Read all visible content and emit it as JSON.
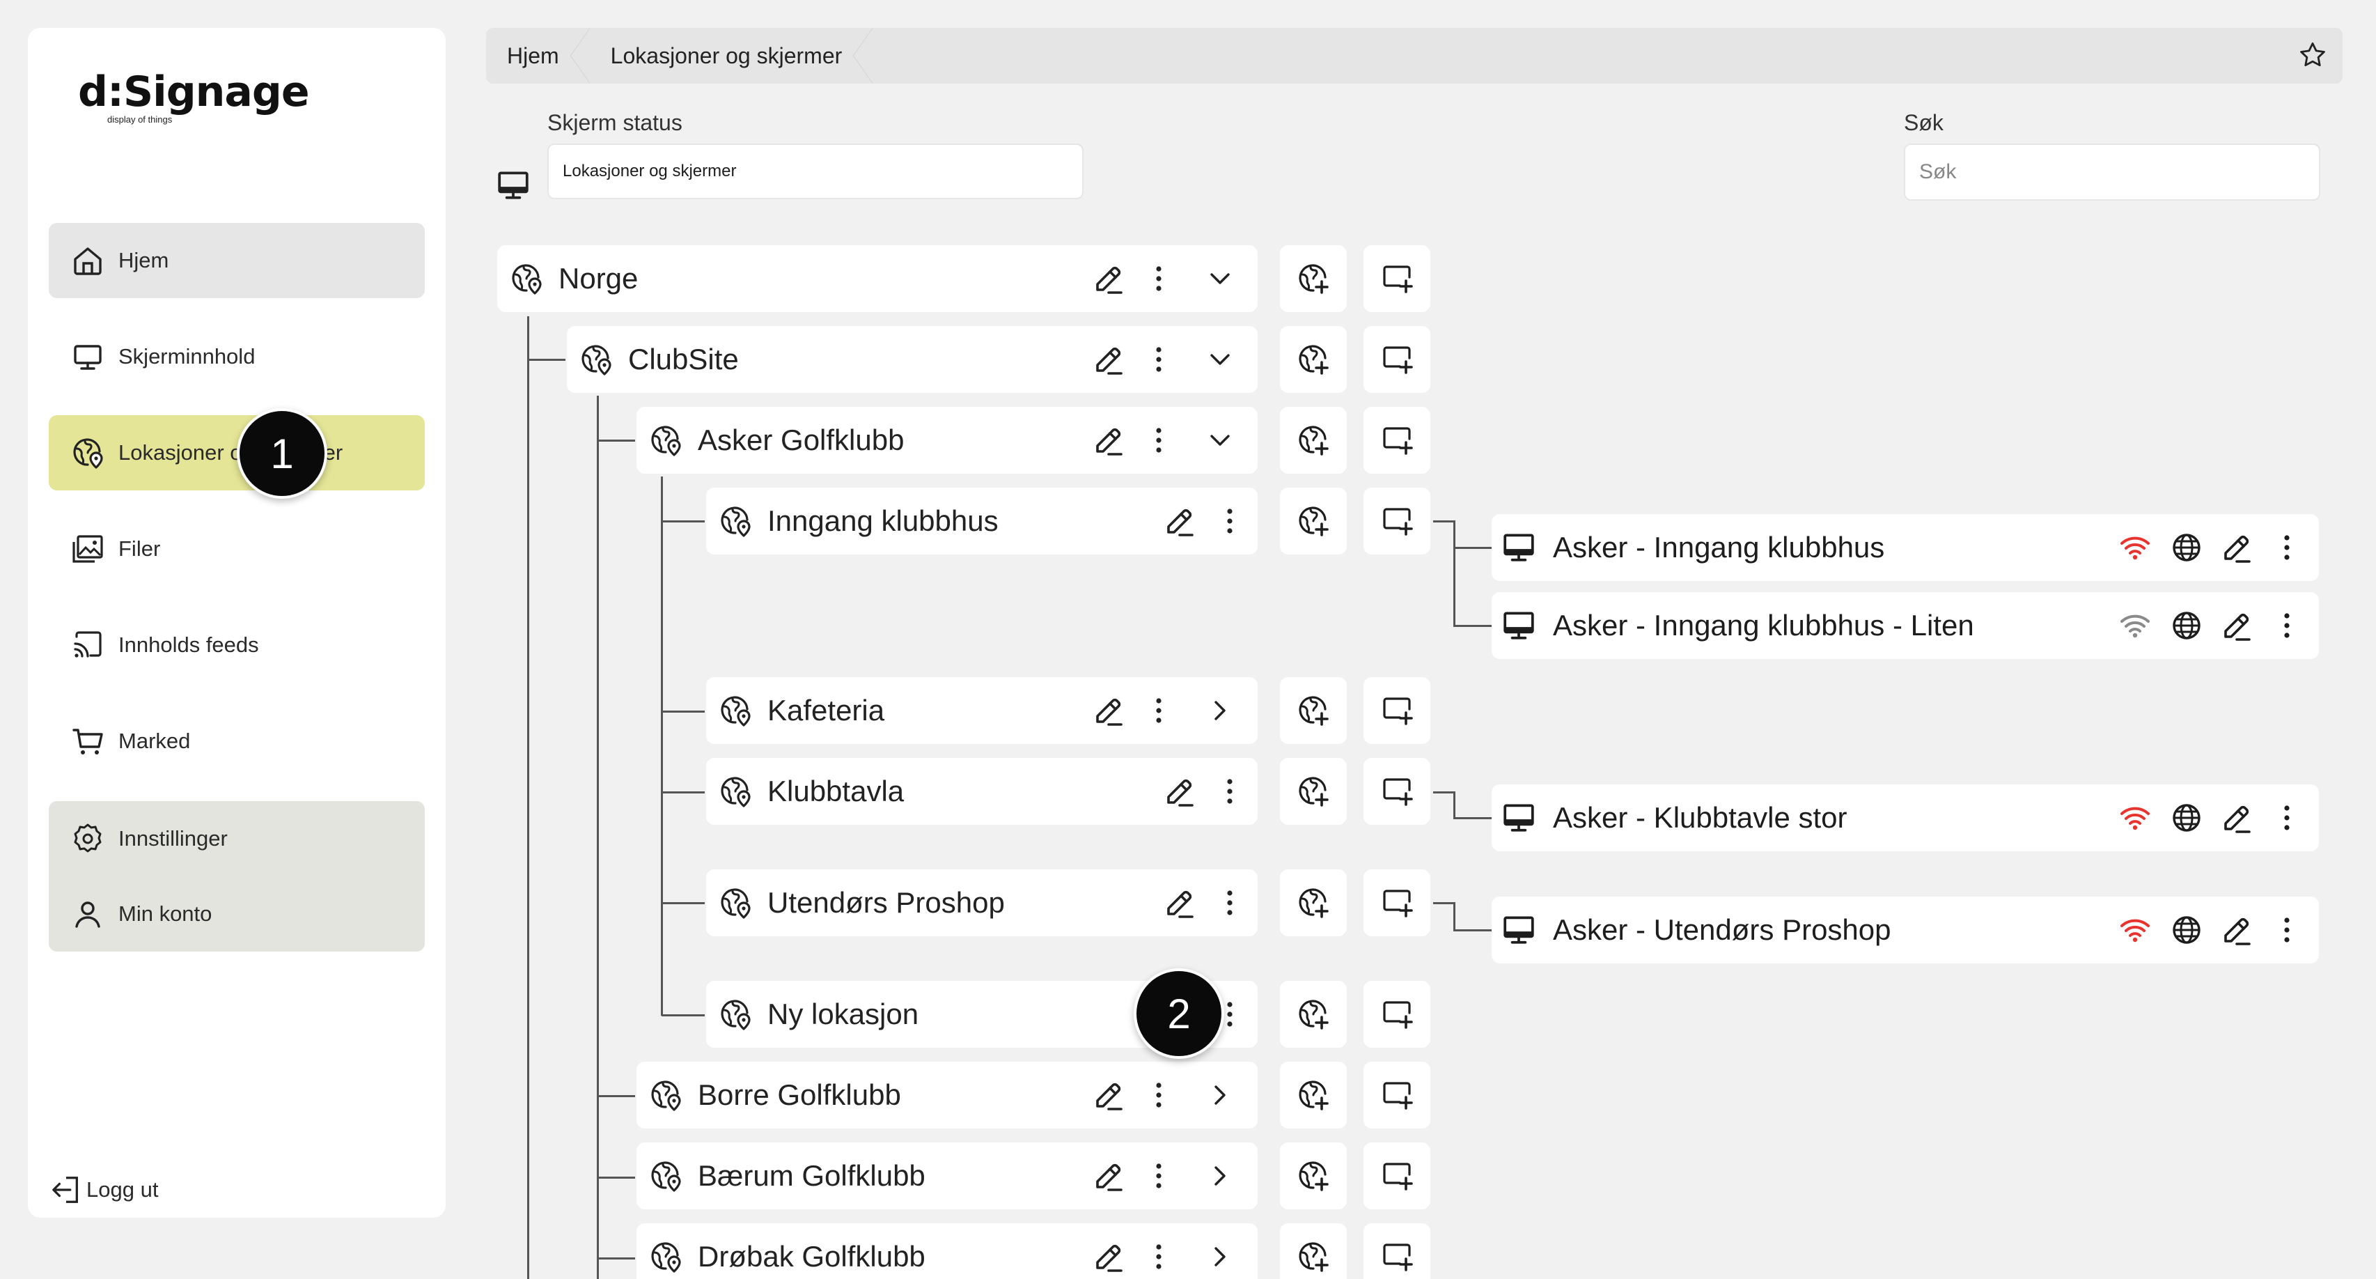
{
  "logo": {
    "name": "d:Signage",
    "tagline": "display of things"
  },
  "sidebar": {
    "items": [
      {
        "label": "Hjem",
        "icon": "home-icon"
      },
      {
        "label": "Skjerminnhold",
        "icon": "monitor-icon"
      },
      {
        "label": "Lokasjoner og skjermer",
        "icon": "location-globe-icon"
      },
      {
        "label": "Filer",
        "icon": "image-icon"
      },
      {
        "label": "Innholds feeds",
        "icon": "cast-icon"
      },
      {
        "label": "Marked",
        "icon": "cart-icon"
      }
    ],
    "settings": [
      {
        "label": "Innstillinger",
        "icon": "gear-icon"
      },
      {
        "label": "Min konto",
        "icon": "user-icon"
      }
    ],
    "logout": "Logg ut"
  },
  "markers": [
    "1",
    "2"
  ],
  "breadcrumb": [
    "Hjem",
    "Lokasjoner og skjermer"
  ],
  "filters": {
    "status_label": "Skjerm status",
    "status_value": "Lokasjoner og skjermer",
    "search_label": "Søk",
    "search_placeholder": "Søk"
  },
  "tree": [
    {
      "name": "Norge",
      "expanded": true
    },
    {
      "name": "ClubSite",
      "expanded": true
    },
    {
      "name": "Asker Golfklubb",
      "expanded": true
    },
    {
      "name": "Inngang klubbhus"
    },
    {
      "name": "Kafeteria",
      "expanded": false
    },
    {
      "name": "Klubbtavla"
    },
    {
      "name": "Utendørs Proshop"
    },
    {
      "name": "Ny lokasjon"
    },
    {
      "name": "Borre Golfklubb",
      "expanded": false
    },
    {
      "name": "Bærum Golfklubb",
      "expanded": false
    },
    {
      "name": "Drøbak Golfklubb",
      "expanded": false
    }
  ],
  "screens": [
    {
      "name": "Asker - Inngang klubbhus",
      "wifi": "online"
    },
    {
      "name": "Asker - Inngang klubbhus - Liten",
      "wifi": "unknown"
    },
    {
      "name": "Asker - Klubbtavle stor",
      "wifi": "online"
    },
    {
      "name": "Asker - Utendørs Proshop",
      "wifi": "online"
    }
  ],
  "colors": {
    "active_nav": "#e4e596",
    "wifi_online": "#e8342f",
    "wifi_unknown": "#8a8a8a"
  }
}
